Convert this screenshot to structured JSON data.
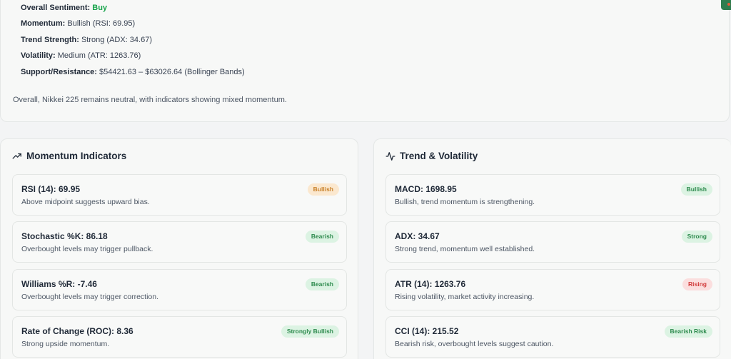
{
  "summary": {
    "rows": [
      {
        "key": "Overall Sentiment:",
        "value": "Buy"
      },
      {
        "key": "Momentum:",
        "value": "Bullish (RSI: 69.95)"
      },
      {
        "key": "Trend Strength:",
        "value": "Strong (ADX: 34.67)"
      },
      {
        "key": "Volatility:",
        "value": "Medium (ATR: 1263.76)"
      },
      {
        "key": "Support/Resistance:",
        "value": "$54421.63 – $63026.64 (Bollinger Bands)"
      }
    ],
    "overall_text": "Overall, Nikkei 225 remains neutral, with indicators showing mixed momentum."
  },
  "momentum": {
    "title": "Momentum Indicators",
    "icon": "trending-up-icon",
    "items": [
      {
        "title": "RSI (14): 69.95",
        "desc": "Above midpoint suggests upward bias.",
        "badge": "Bullish",
        "badge_color": "#c9822b"
      },
      {
        "title": "Stochastic %K: 86.18",
        "desc": "Overbought levels may trigger pullback.",
        "badge": "Bearish",
        "badge_color": "#2e8b4e"
      },
      {
        "title": "Williams %R: -7.46",
        "desc": "Overbought levels may trigger correction.",
        "badge": "Bearish",
        "badge_color": "#2e8b4e"
      },
      {
        "title": "Rate of Change (ROC): 8.36",
        "desc": "Strong upside momentum.",
        "badge": "Strongly Bullish",
        "badge_color": "#2e8b4e"
      }
    ]
  },
  "trend": {
    "title": "Trend & Volatility",
    "icon": "activity-icon",
    "items": [
      {
        "title": "MACD: 1698.95",
        "desc": "Bullish, trend momentum is strengthening.",
        "badge": "Bullish",
        "badge_color": "#2e8b4e"
      },
      {
        "title": "ADX: 34.67",
        "desc": "Strong trend, momentum well established.",
        "badge": "Strong",
        "badge_color": "#2e8b4e"
      },
      {
        "title": "ATR (14): 1263.76",
        "desc": "Rising volatility, market activity increasing.",
        "badge": "Rising",
        "badge_color": "#d23c3c"
      },
      {
        "title": "CCI (14): 215.52",
        "desc": "Bearish risk, overbought levels suggest caution.",
        "badge": "Bearish Risk",
        "badge_color": "#2e8b4e"
      }
    ]
  }
}
